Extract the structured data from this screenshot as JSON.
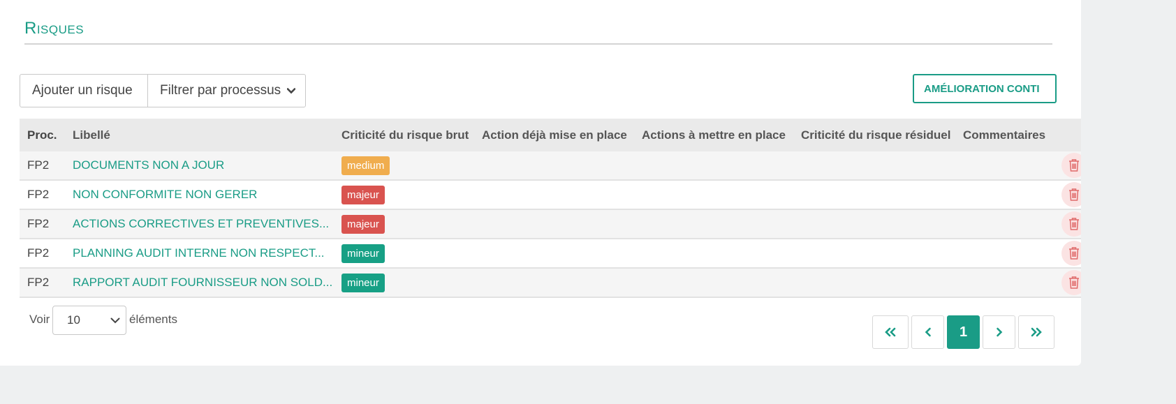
{
  "section": {
    "title": "Risques"
  },
  "toolbar": {
    "add_label": "Ajouter un risque",
    "filter_label": "Filtrer par processus",
    "improvement_label": "AMÉLIORATION CONTI"
  },
  "table": {
    "headers": [
      "Proc.",
      "Libellé",
      "Criticité du risque brut",
      "Action déjà mise en place",
      "Actions à mettre en place",
      "Criticité du risque résiduel",
      "Commentaires"
    ],
    "rows": [
      {
        "proc": "FP2",
        "libelle": "DOCUMENTS NON A JOUR",
        "criticite": "medium",
        "action": "",
        "actions_a_mettre": "",
        "residuel": "",
        "commentaires": ""
      },
      {
        "proc": "FP2",
        "libelle": "NON CONFORMITE NON GERER",
        "criticite": "majeur",
        "action": "",
        "actions_a_mettre": "",
        "residuel": "",
        "commentaires": ""
      },
      {
        "proc": "FP2",
        "libelle": "ACTIONS CORRECTIVES ET PREVENTIVES...",
        "criticite": "majeur",
        "action": "",
        "actions_a_mettre": "",
        "residuel": "",
        "commentaires": ""
      },
      {
        "proc": "FP2",
        "libelle": "PLANNING AUDIT INTERNE NON RESPECT...",
        "criticite": "mineur",
        "action": "",
        "actions_a_mettre": "",
        "residuel": "",
        "commentaires": ""
      },
      {
        "proc": "FP2",
        "libelle": "RAPPORT AUDIT FOURNISSEUR NON SOLD...",
        "criticite": "mineur",
        "action": "",
        "actions_a_mettre": "",
        "residuel": "",
        "commentaires": ""
      }
    ]
  },
  "badge_colors": {
    "medium": "#f0ad4e",
    "majeur": "#d9534f",
    "mineur": "#17a085"
  },
  "icons": {
    "delete": "trash-icon",
    "filter": "chevron-down-icon"
  },
  "footer": {
    "show_label": "Voir",
    "page_size": "10",
    "elements_label": "éléments"
  },
  "pagination": {
    "first": "«",
    "prev": "‹",
    "current": "1",
    "next": "›",
    "last": "»"
  },
  "colors": {
    "accent": "#1a9c86",
    "delete": "#e06b6b"
  }
}
